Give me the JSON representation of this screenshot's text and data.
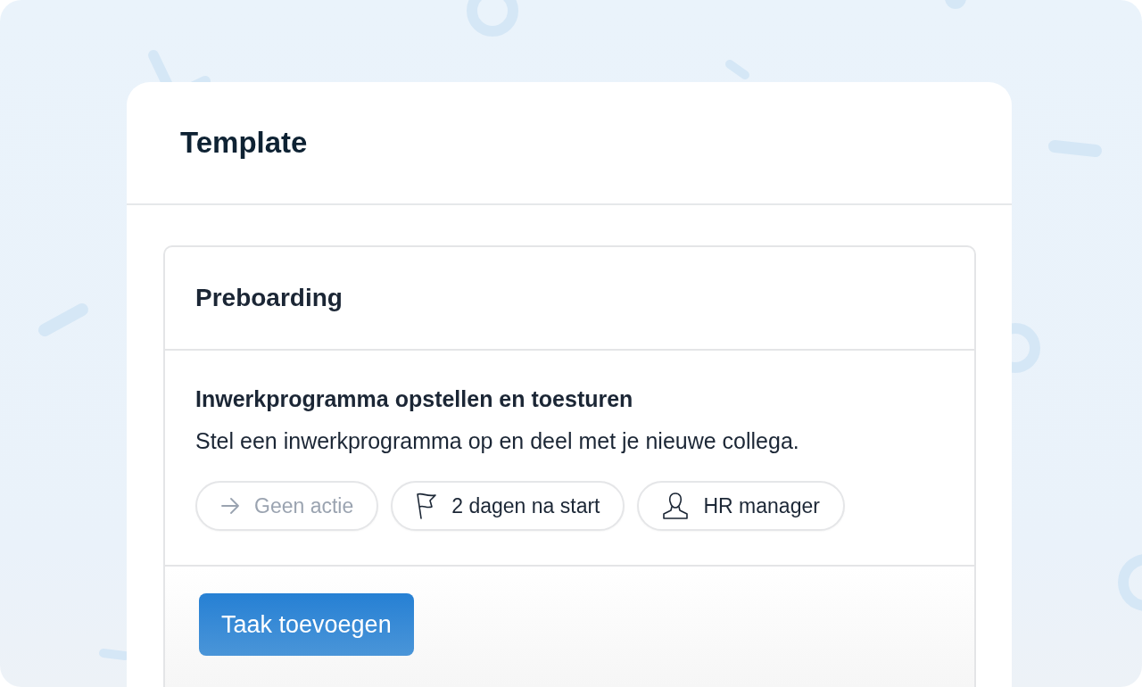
{
  "card": {
    "title": "Template"
  },
  "section": {
    "title": "Preboarding",
    "task": {
      "title": "Inwerkprogramma opstellen en toesturen",
      "description": "Stel een inwerkprogramma op en deel met je nieuwe collega.",
      "chips": [
        {
          "kind": "action",
          "label": "Geen actie",
          "disabled": true
        },
        {
          "kind": "deadline",
          "label": "2 dagen na start",
          "disabled": false
        },
        {
          "kind": "assignee",
          "label": "HR manager",
          "disabled": false
        }
      ]
    }
  },
  "add_button": "Taak toevoegen"
}
